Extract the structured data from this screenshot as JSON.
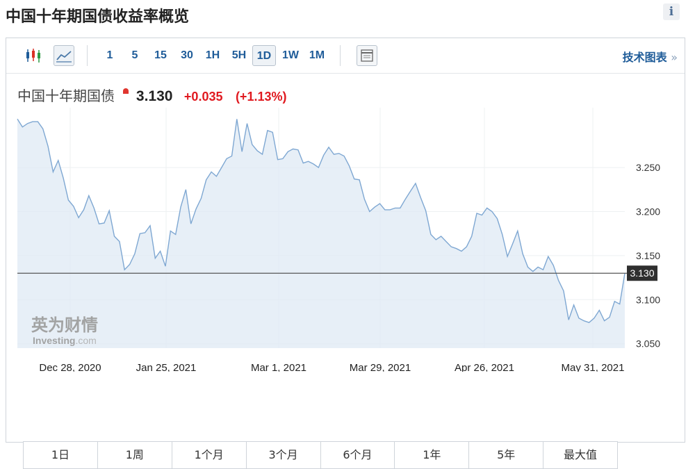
{
  "page": {
    "title": "中国十年期国债收益率概览",
    "info_label": "i"
  },
  "toolbar": {
    "candlestick_icon": "candlestick-chart-icon",
    "line_icon": "line-chart-icon",
    "table_icon": "table-icon",
    "intervals": [
      "1",
      "5",
      "15",
      "30",
      "1H",
      "5H",
      "1D",
      "1W",
      "1M"
    ],
    "active_interval": "1D",
    "tech_chart_label": "技术图表",
    "tech_chart_chevron": "»"
  },
  "quote": {
    "name": "中国十年期国债",
    "price": "3.130",
    "change": "+0.035",
    "change_pct": "(+1.13%)"
  },
  "watermark": {
    "cn": "英为财情",
    "en": "Investing",
    "suffix": ".com"
  },
  "chart_data": {
    "type": "area",
    "x_ticks": [
      "Dec 28, 2020",
      "Jan 25, 2021",
      "Mar 1, 2021",
      "Mar 29, 2021",
      "Apr 26, 2021",
      "May 31, 2021"
    ],
    "y_ticks": [
      "3.250",
      "3.200",
      "3.150",
      "3.100",
      "3.050"
    ],
    "ylim": [
      3.045,
      3.31
    ],
    "current_value": 3.13,
    "current_label": "3.130",
    "values": [
      3.305,
      3.296,
      3.3,
      3.302,
      3.302,
      3.294,
      3.274,
      3.245,
      3.258,
      3.238,
      3.213,
      3.206,
      3.193,
      3.202,
      3.218,
      3.204,
      3.186,
      3.187,
      3.201,
      3.172,
      3.166,
      3.134,
      3.14,
      3.152,
      3.175,
      3.176,
      3.184,
      3.147,
      3.155,
      3.138,
      3.178,
      3.174,
      3.205,
      3.225,
      3.186,
      3.203,
      3.215,
      3.236,
      3.245,
      3.24,
      3.25,
      3.26,
      3.263,
      3.305,
      3.268,
      3.3,
      3.276,
      3.269,
      3.265,
      3.292,
      3.29,
      3.259,
      3.26,
      3.268,
      3.271,
      3.27,
      3.255,
      3.257,
      3.254,
      3.25,
      3.264,
      3.273,
      3.265,
      3.266,
      3.263,
      3.252,
      3.237,
      3.236,
      3.214,
      3.2,
      3.205,
      3.209,
      3.202,
      3.202,
      3.204,
      3.204,
      3.214,
      3.223,
      3.232,
      3.216,
      3.201,
      3.174,
      3.168,
      3.172,
      3.166,
      3.16,
      3.158,
      3.155,
      3.16,
      3.172,
      3.198,
      3.196,
      3.204,
      3.2,
      3.192,
      3.174,
      3.149,
      3.163,
      3.178,
      3.152,
      3.137,
      3.132,
      3.137,
      3.134,
      3.149,
      3.139,
      3.122,
      3.11,
      3.077,
      3.094,
      3.079,
      3.076,
      3.074,
      3.079,
      3.088,
      3.076,
      3.08,
      3.098,
      3.095,
      3.13
    ]
  },
  "ranges": [
    "1日",
    "1周",
    "1个月",
    "3个月",
    "6个月",
    "1年",
    "5年",
    "最大值"
  ]
}
